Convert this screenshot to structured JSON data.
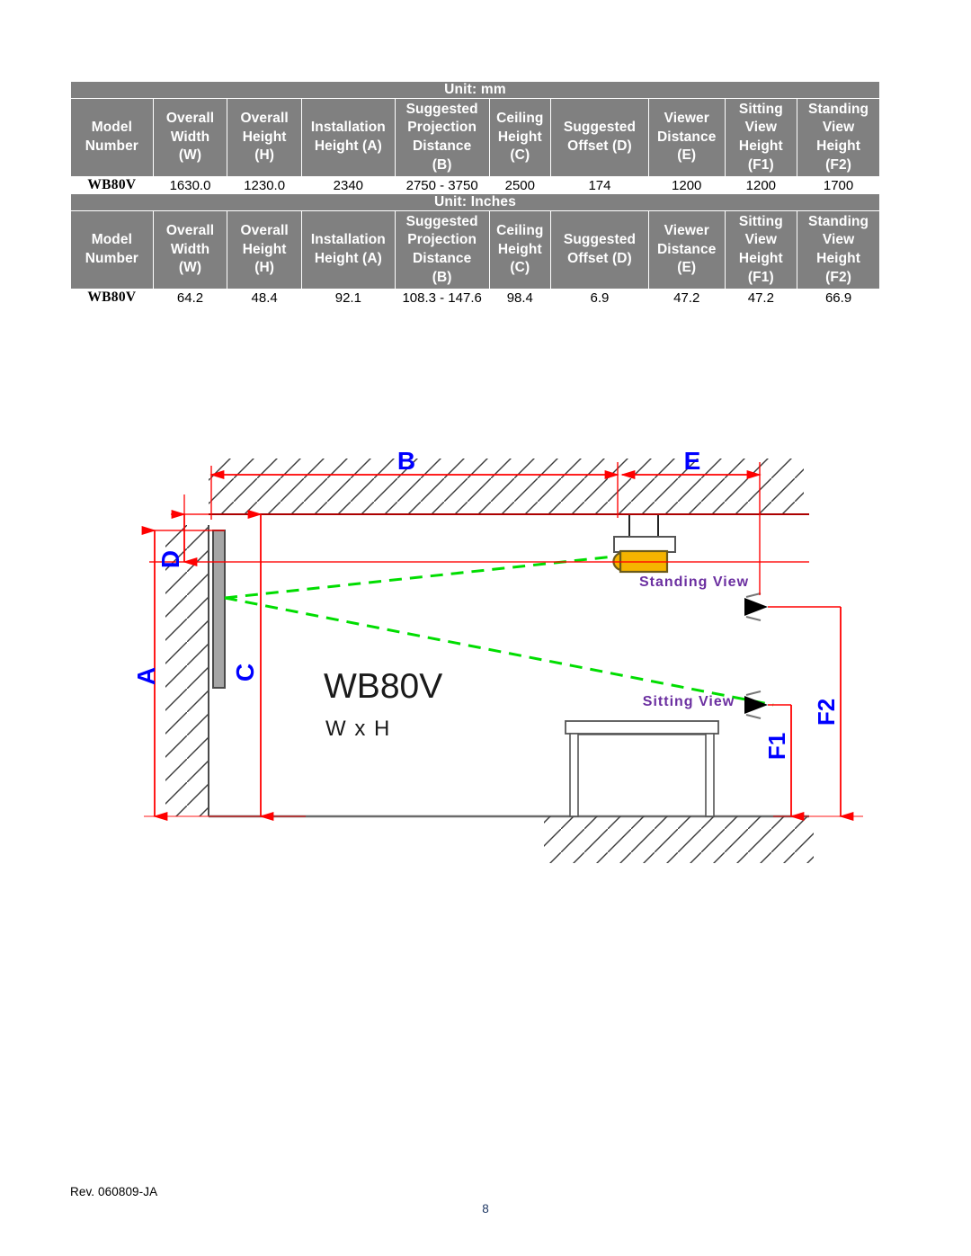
{
  "document": {
    "model": "WB80V",
    "footer": {
      "revision": "Rev. 060809-JA",
      "page_number": "8"
    }
  },
  "tables": [
    {
      "unit_label": "Unit: mm",
      "headers": [
        "Model\nNumber",
        "Overall\nWidth\n(W)",
        "Overall\nHeight\n(H)",
        "Installation\nHeight (A)",
        "Suggested\nProjection\nDistance\n(B)",
        "Ceiling\nHeight\n(C)",
        "Suggested\nOffset (D)",
        "Viewer\nDistance\n(E)",
        "Sitting\nView\nHeight\n(F1)",
        "Standing\nView\nHeight\n(F2)"
      ],
      "header_lines": [
        [
          "Model",
          "Number"
        ],
        [
          "Overall",
          "Width",
          "(W)"
        ],
        [
          "Overall",
          "Height",
          "(H)"
        ],
        [
          "Installation",
          "Height (A)"
        ],
        [
          "Suggested",
          "Projection",
          "Distance",
          "(B)"
        ],
        [
          "Ceiling",
          "Height",
          "(C)"
        ],
        [
          "Suggested",
          "Offset (D)"
        ],
        [
          "Viewer",
          "Distance",
          "(E)"
        ],
        [
          "Sitting",
          "View",
          "Height",
          "(F1)"
        ],
        [
          "Standing",
          "View",
          "Height",
          "(F2)"
        ]
      ],
      "row": [
        "WB80V",
        "1630.0",
        "1230.0",
        "2340",
        "2750 - 3750",
        "2500",
        "174",
        "1200",
        "1200",
        "1700"
      ]
    },
    {
      "unit_label": "Unit: Inches",
      "headers": [
        "Model\nNumber",
        "Overall\nWidth\n(W)",
        "Overall\nHeight\n(H)",
        "Installation\nHeight (A)",
        "Suggested\nProjection\nDistance\n(B)",
        "Ceiling\nHeight\n(C)",
        "Suggested\nOffset (D)",
        "Viewer\nDistance\n(E)",
        "Sitting\nView\nHeight\n(F1)",
        "Standing\nView\nHeight\n(F2)"
      ],
      "header_lines": [
        [
          "Model",
          "Number"
        ],
        [
          "Overall",
          "Width",
          "(W)"
        ],
        [
          "Overall",
          "Height",
          "(H)"
        ],
        [
          "Installation",
          "Height (A)"
        ],
        [
          "Suggested",
          "Projection",
          "Distance",
          "(B)"
        ],
        [
          "Ceiling",
          "Height",
          "(C)"
        ],
        [
          "Suggested",
          "Offset (D)"
        ],
        [
          "Viewer",
          "Distance",
          "(E)"
        ],
        [
          "Sitting",
          "View",
          "Height",
          "(F1)"
        ],
        [
          "Standing",
          "View",
          "Height",
          "(F2)"
        ]
      ],
      "row": [
        "WB80V",
        "64.2",
        "48.4",
        "92.1",
        "108.3 - 147.6",
        "98.4",
        "6.9",
        "47.2",
        "47.2",
        "66.9"
      ]
    }
  ],
  "diagram": {
    "dimension_labels": {
      "a": "A",
      "b": "B",
      "c": "C",
      "d": "D",
      "e": "E",
      "f1": "F1",
      "f2": "F2"
    },
    "board_title": "WB80V",
    "board_subtitle": "W x H",
    "standing_view_label": "Standing View",
    "sitting_view_label": "Sitting View",
    "colors": {
      "dimension_line": "#FF0000",
      "dimension_text": "#0000FF",
      "projection_ray": "#00DD00",
      "view_label": "#6B2FA0",
      "projector_body": "#F5B400",
      "board": "#A6A6A6",
      "structure": "#404040"
    }
  }
}
